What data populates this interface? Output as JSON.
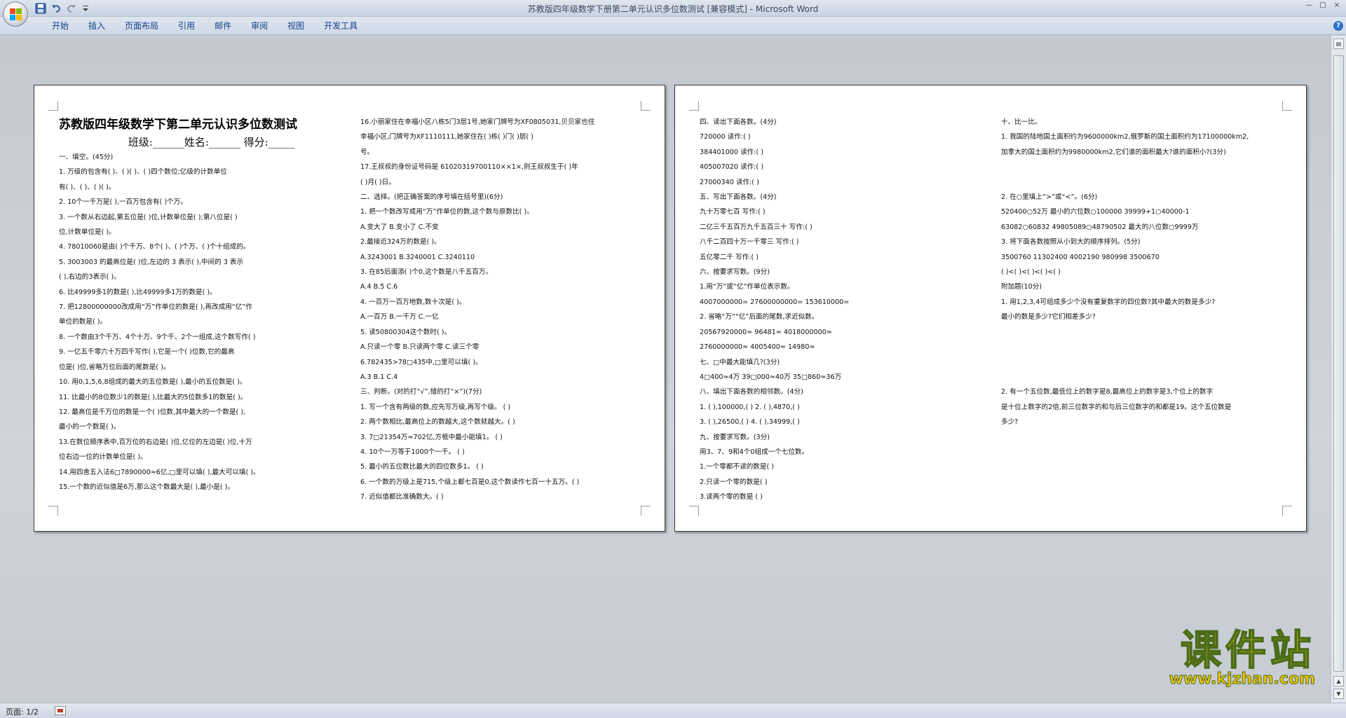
{
  "window": {
    "title": "苏教版四年级数学下册第二单元认识多位数测试 [兼容模式] - Microsoft Word",
    "controls": [
      "—",
      "□",
      "×"
    ]
  },
  "quick_access": {
    "icons": [
      "save-icon",
      "undo-icon",
      "redo-icon",
      "customize-icon"
    ]
  },
  "ribbon": {
    "tabs": [
      "开始",
      "插入",
      "页面布局",
      "引用",
      "邮件",
      "审阅",
      "视图",
      "开发工具"
    ],
    "help": "?"
  },
  "status": {
    "page": "页面: 1/2"
  },
  "watermark": {
    "text": "课件站",
    "url": "www.kjzhan.com"
  },
  "pages": [
    {
      "col1": {
        "title": "苏教版四年级数学下第二单元认识多位数测试",
        "subtitle": "班级:______姓名:______ 得分:_____",
        "lines": [
          "一、填空。(45分)",
          "1.   万级的包含有(     )、(     )(     )、(     )四个数位;亿级的计数单位",
          "有(     )、(     )、(     )(     )。",
          "2.  10个一千万是(     ),一百万包含有(     )个万。",
          "3.  一个数从右边起,第五位是(     )位,计数单位是(     );第八位是(     )",
          "位,计数单位是(     )。",
          "4.  78010060是由(   )个千万、8个(     )、(     )个万、(     )个十组成的。",
          "5.  3003003 的最高位是(     )位,左边的 3 表示(     ),中间的 3 表示",
          "(     ),右边的3表示(     )。",
          "6.  比49999多1的数是(     ),比49999多1万的数是(     )。",
          "7.  把12800000000改成用“万”作单位的数是(     ),再改成用“亿”作",
          "单位的数是(     )。",
          "8.  一个数由3个千万、4个十万、9个千、2个一组成,这个数写作(     )",
          "9.  一亿五千零六十万四千写作(     ),它是一个(     )位数,它的最高",
          "位是(     )位,省略万位后面的尾数是(     )。",
          "10.  用0,1,5,6,8组成的最大的五位数是(     ),最小的五位数是(     )。",
          "11.  比最小的8位数少1的数是(     ),比最大的5位数多1的数是(     )。",
          "12.  最高位是千万位的数是一个(     )位数,其中最大的一个数是(     ),",
          "最小的一个数是(     )。",
          "13.在数位顺序表中,百万位的右边是(   )位,亿位的左边是(     )位,十万",
          "位右边一位的计数单位是(     )。",
          "14.用四舍五入法6□7890000≈6亿,□里可以填(     ),最大可以填(     )。",
          "15.一个数的近似值是6万,那么这个数最大是(     ),最小是(     )。"
        ]
      },
      "col2": {
        "lines": [
          "16.小丽家住在幸福小区八栋5门3层1号,她家门牌号为XF0805031,贝贝家也住",
          "幸福小区,门牌号为XF1110111,她家住在(     )栋(     )门(     )层(     )",
          "号。",
          "17.王叔叔的身份证号码是 61020319700110××1×,则王叔叔生于(     )年",
          "(     )月(     )日。",
          "二、选择。(把正确答案的序号填在括号里)(6分)",
          "1.  把一个数改写成用“万”作单位的数,这个数与原数比(     )。",
          "   A.变大了     B.变小了     C.不变",
          "2.最接近324万的数是(     )。",
          "   A.3243001     B.3240001     C.3240110",
          "3.  在85后面添(     )个0,这个数是八千五百万。",
          "   A.4     B.5     C.6",
          "4.  一百万一百万地数,数十次是(     )。",
          "   A.一百万     B.一千万     C.一亿",
          "5.  读50800304这个数时(     )。",
          "   A.只读一个零     B.只读两个零     C.读三个零",
          "6.782435>78□435中,□里可以填(     )。",
          "   A.3          B.1          C.4",
          "三、判断。(对的打“√”,错的打“×”)(7分)",
          "1.  写一个含有两级的数,应先写万级,再写个级。     (     )",
          "2.  两个数相比,最高位上的数越大,这个数就越大。(     )",
          "3.  7□21354万≈702亿,方框中最小能填1。     (     )",
          "4.  10个一万等于1000个一千。     (     )",
          "5.  最小的五位数比最大的四位数多1。     (     )",
          "6.  一个数的万级上是715,个级上都七百是0,这个数读作七百一十五万。(     )",
          "7.  近似值都比准确数大。(     )"
        ]
      }
    },
    {
      "col1": {
        "lines": [
          "四、读出下面各数。(4分)",
          "720000          读作:(                              )",
          "384401000       读作:(                              )",
          "405007020       读作:(                              )",
          "27000340        读作:(                              )",
          "五、写出下面各数。(4分)",
          "九十万零七百                     写作:(               )",
          "二亿三千五百万九千五百三十        写作:(               )",
          "八千二百四十万一千零三            写作:(               )",
          "五亿零二千                       写作:(               )",
          "六、按要求写数。(9分)",
          "1.用“万”或“亿”作单位表示数。",
          "4007000000=            27600000000=            153610000=",
          "2.  省略“万”“亿”后面的尾数,求近似数。",
          "20567920000≈          96481≈               4018000000≈",
          "2760000000≈           4005400≈              14980≈",
          "七、□中最大能填几?(3分)",
          "4□400≈4万           39□000≈40万          35□860≈36万",
          "八、填出下面各数的相邻数。(4分)",
          "1.  (     ),100000,(     )      2.  (     ),4870,(     )",
          "3.  (     ),26500,(     )        4.  (     ),34999,(     )",
          "九、按要求写数。(3分)",
          "      用3、7、9和4个0组成一个七位数。",
          "1.一个零都不读的数是(               )",
          "2.只读一个零的数是(               )",
          "3.读两个零的数是  (               )"
        ]
      },
      "col2": {
        "lines": [
          "十、比一比。",
          "  1.   我国的陆地国土面积约为9600000km2,俄罗斯的国土面积约为17100000km2,",
          "加拿大的国土面积约为9980000km2,它们谁的面积最大?谁的面积小?(3分)",
          "",
          "",
          "2.   在○里填上“>”或“<”。(6分)",
          "520400○52万       最小的六位数○100000       39999+1○40000-1",
          "63082○60832       49805089○48790502       最大的八位数○9999万",
          "3.  将下面各数按照从小到大的顺序排列。(5分)",
          "3500760     11302400     4002190     980998     3500670",
          "(     )<(     )<(     )<(     )<(     )",
          "附加题(10分)",
          "   1.  用1,2,3,4可组成多少个没有重复数字的四位数?其中最大的数是多少?",
          "最小的数是多少?它们相差多少?",
          "",
          "",
          "",
          "",
          "   2.  有一个五位数,最低位上的数字是8,最高位上的数字是3,个位上的数字",
          "是十位上数字的2倍,前三位数字的和与后三位数字的和都是19。这个五位数是",
          "多少?",
          "",
          ""
        ]
      }
    }
  ]
}
